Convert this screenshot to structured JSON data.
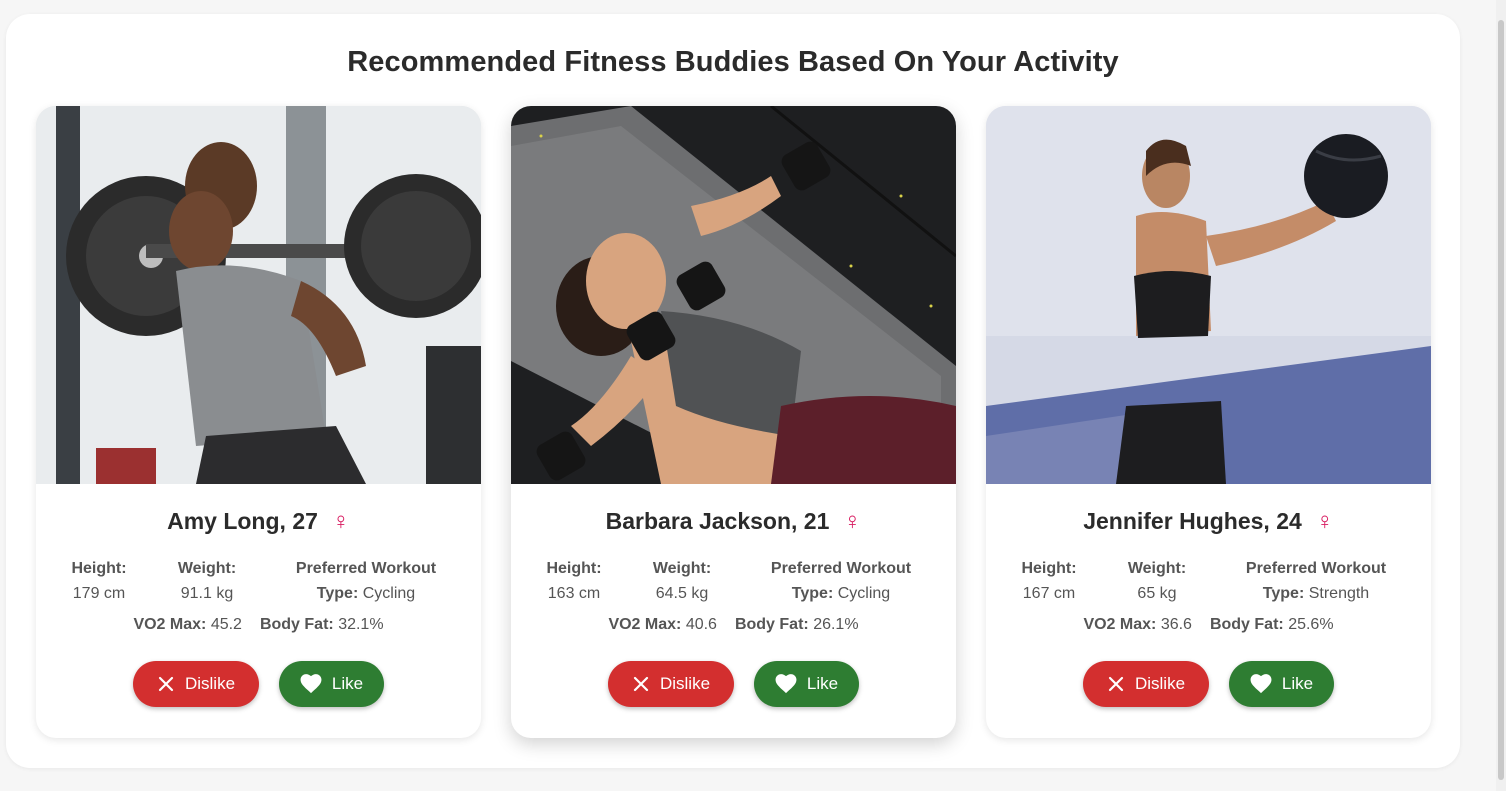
{
  "title": "Recommended Fitness Buddies Based On Your Activity",
  "labels": {
    "height": "Height:",
    "weight": "Weight:",
    "workout_line1": "Preferred Workout",
    "workout_line2": "Type:",
    "vo2": "VO2 Max:",
    "bodyfat": "Body Fat:",
    "dislike": "Dislike",
    "like": "Like",
    "gender_symbol": "♀"
  },
  "colors": {
    "dislike": "#d32f2f",
    "like": "#2e7d32",
    "gender": "#d81b60"
  },
  "cards": [
    {
      "name": "Amy Long, 27",
      "height": "179 cm",
      "weight": "91.1 kg",
      "workout": "Cycling",
      "vo2": "45.2",
      "bodyfat": "32.1%",
      "photo": "woman-barbell-squat-photo"
    },
    {
      "name": "Barbara Jackson, 21",
      "height": "163 cm",
      "weight": "64.5 kg",
      "workout": "Cycling",
      "vo2": "40.6",
      "bodyfat": "26.1%",
      "photo": "woman-dumbbell-press-photo"
    },
    {
      "name": "Jennifer Hughes, 24",
      "height": "167 cm",
      "weight": "65 kg",
      "workout": "Strength",
      "vo2": "36.6",
      "bodyfat": "25.6%",
      "photo": "woman-medicine-ball-photo"
    }
  ]
}
